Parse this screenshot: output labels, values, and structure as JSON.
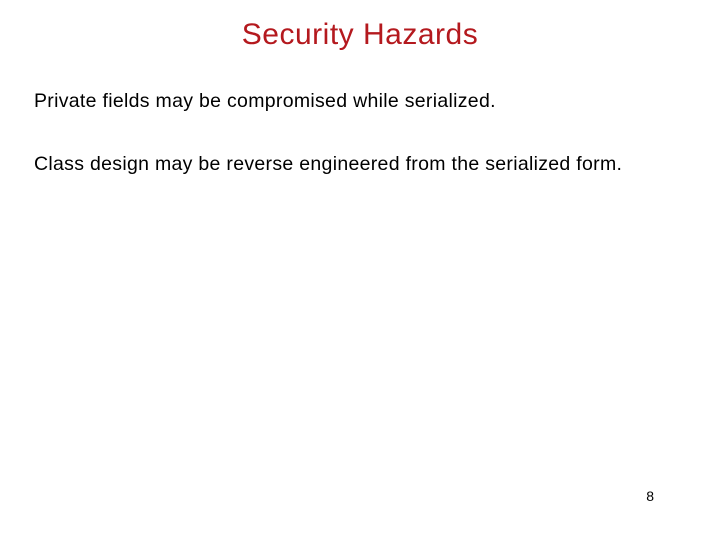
{
  "slide": {
    "title": "Security Hazards",
    "paragraphs": [
      "Private fields may be compromised while serialized.",
      "Class design may be reverse engineered from the serialized form."
    ],
    "page_number": "8"
  }
}
